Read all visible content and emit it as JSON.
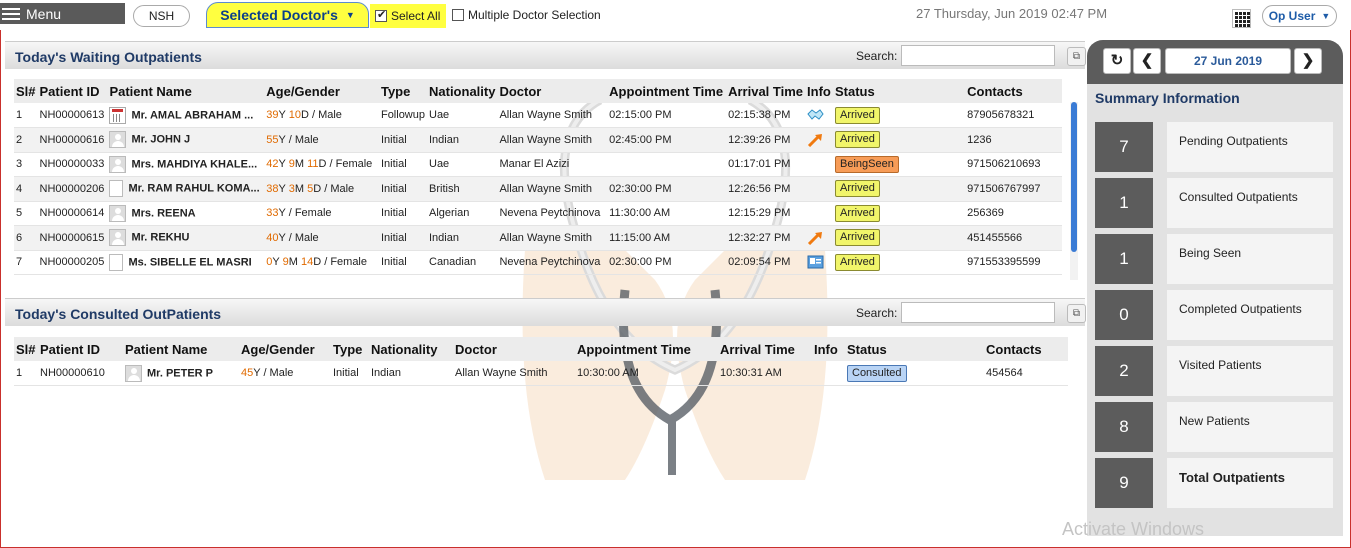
{
  "topbar": {
    "menu_label": "Menu",
    "hospital": "NSH",
    "doctor_selector": "Selected Doctor's",
    "select_all": "Select All",
    "multiple_selection": "Multiple Doctor Selection",
    "datetime": "27 Thursday, Jun 2019  02:47 PM",
    "user": "Op User"
  },
  "waiting": {
    "title": "Today's Waiting Outpatients",
    "search_label": "Search:",
    "columns": [
      "Sl#",
      "Patient ID",
      "Patient Name",
      "Age/Gender",
      "Type",
      "Nationality",
      "Doctor",
      "Appointment Time",
      "Arrival Time",
      "Info",
      "Status",
      "Contacts"
    ],
    "rows": [
      {
        "sl": "1",
        "id": "NH00000613",
        "name": "Mr. AMAL ABRAHAM ...",
        "age_y": "39",
        "age_mid": "Y ",
        "age_d": "10",
        "age_rest": "D / Male",
        "type": "Followup",
        "nationality": "Uae",
        "doctor": "Allan Wayne Smith",
        "appt": "02:15:00 PM",
        "arrival": "02:15:38 PM",
        "info": "handshake-icon",
        "status": "Arrived",
        "contacts": "87905678321"
      },
      {
        "sl": "2",
        "id": "NH00000616",
        "name": "Mr. JOHN J",
        "age_y": "55",
        "age_mid": "Y / Male",
        "age_d": "",
        "age_rest": "",
        "type": "Initial",
        "nationality": "Indian",
        "doctor": "Allan Wayne Smith",
        "appt": "02:45:00 PM",
        "arrival": "12:39:26 PM",
        "info": "arrow-icon",
        "status": "Arrived",
        "contacts": "1236"
      },
      {
        "sl": "3",
        "id": "NH00000033",
        "name": "Mrs. MAHDIYA KHALE...",
        "age_y": "42",
        "age_mid": "Y ",
        "age_m": "9",
        "age_d": "11",
        "age_rest": "D / Female",
        "type": "Initial",
        "nationality": "Uae",
        "doctor": "Manar El Azizi",
        "appt": "",
        "arrival": "01:17:01 PM",
        "info": "",
        "status": "BeingSeen",
        "contacts": "971506210693"
      },
      {
        "sl": "4",
        "id": "NH00000206",
        "name": "Mr. RAM RAHUL KOMA...",
        "age_y": "38",
        "age_mid": "Y ",
        "age_m": "3",
        "age_d": "5",
        "age_rest": "D / Male",
        "type": "Initial",
        "nationality": "British",
        "doctor": "Allan Wayne Smith",
        "appt": "02:30:00 PM",
        "arrival": "12:26:56 PM",
        "info": "",
        "status": "Arrived",
        "contacts": "971506767997"
      },
      {
        "sl": "5",
        "id": "NH00000614",
        "name": "Mrs. REENA",
        "age_y": "33",
        "age_mid": "Y / Female",
        "age_d": "",
        "age_rest": "",
        "type": "Initial",
        "nationality": "Algerian",
        "doctor": "Nevena Peytchinova",
        "appt": "11:30:00 AM",
        "arrival": "12:15:29 PM",
        "info": "",
        "status": "Arrived",
        "contacts": "256369"
      },
      {
        "sl": "6",
        "id": "NH00000615",
        "name": "Mr. REKHU",
        "age_y": "40",
        "age_mid": "Y / Male",
        "age_d": "",
        "age_rest": "",
        "type": "Initial",
        "nationality": "Indian",
        "doctor": "Allan Wayne Smith",
        "appt": "11:15:00 AM",
        "arrival": "12:32:27 PM",
        "info": "arrow-icon",
        "status": "Arrived",
        "contacts": "451455566"
      },
      {
        "sl": "7",
        "id": "NH00000205",
        "name": "Ms. SIBELLE EL MASRI",
        "age_y": "0",
        "age_mid": "Y ",
        "age_m": "9",
        "age_d": "14",
        "age_rest": "D / Female",
        "type": "Initial",
        "nationality": "Canadian",
        "doctor": "Nevena Peytchinova",
        "appt": "02:30:00 PM",
        "arrival": "02:09:54 PM",
        "info": "id-card-icon",
        "status": "Arrived",
        "contacts": "971553395599"
      }
    ]
  },
  "consulted": {
    "title": "Today's Consulted OutPatients",
    "search_label": "Search:",
    "columns": [
      "Sl#",
      "Patient ID",
      "Patient Name",
      "Age/Gender",
      "Type",
      "Nationality",
      "Doctor",
      "Appointment Time",
      "Arrival Time",
      "Info",
      "Status",
      "Contacts"
    ],
    "rows": [
      {
        "sl": "1",
        "id": "NH00000610",
        "name": "Mr. PETER P",
        "age_y": "45",
        "age_mid": "Y / Male",
        "type": "Initial",
        "nationality": "Indian",
        "doctor": "Allan Wayne Smith",
        "appt": "10:30:00 AM",
        "arrival": "10:30:31 AM",
        "info": "",
        "status": "Consulted",
        "contacts": "454564"
      }
    ]
  },
  "summary": {
    "date": "27 Jun 2019",
    "title": "Summary Information",
    "items": [
      {
        "count": "7",
        "label": "Pending Outpatients"
      },
      {
        "count": "1",
        "label": "Consulted Outpatients"
      },
      {
        "count": "1",
        "label": "Being Seen"
      },
      {
        "count": "0",
        "label": "Completed Outpatients"
      },
      {
        "count": "2",
        "label": "Visited Patients"
      },
      {
        "count": "8",
        "label": "New Patients"
      },
      {
        "count": "9",
        "label": "Total Outpatients"
      }
    ]
  },
  "os_watermark": "Activate Windows",
  "colors": {
    "accent": "#ffff40",
    "header_text": "#1f3a66",
    "age_highlight": "#e06a00",
    "arrived": "#f1f56a",
    "being_seen": "#f79c57",
    "consulted": "#b9d4f5"
  }
}
